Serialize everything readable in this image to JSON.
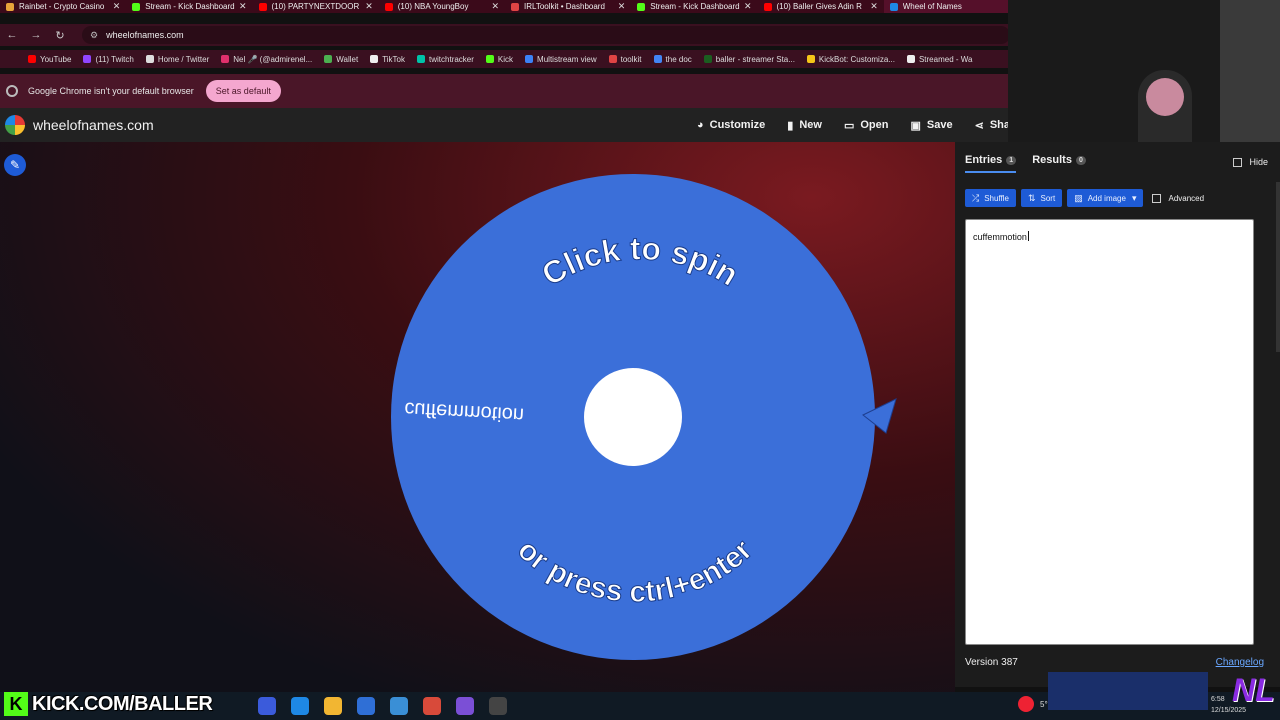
{
  "browser": {
    "tabs": [
      {
        "title": "Rainbet - Crypto Casino",
        "color": "#e8a33a"
      },
      {
        "title": "Stream - Kick Dashboard",
        "color": "#53fc18"
      },
      {
        "title": "(10) PARTYNEXTDOOR",
        "color": "#ff0000"
      },
      {
        "title": "(10) NBA YoungBoy",
        "color": "#ff0000"
      },
      {
        "title": "IRLToolkit • Dashboard",
        "color": "#e04444"
      },
      {
        "title": "Stream - Kick Dashboard",
        "color": "#53fc18"
      },
      {
        "title": "(10) Baller Gives Adin R",
        "color": "#ff0000"
      },
      {
        "title": "Wheel of Names",
        "color": "#1e88e5"
      }
    ],
    "url": "wheelofnames.com",
    "bookmarks": [
      {
        "label": "YouTube",
        "color": "#ff0000"
      },
      {
        "label": "(11) Twitch",
        "color": "#9146ff"
      },
      {
        "label": "Home / Twitter",
        "color": "#dddddd"
      },
      {
        "label": "Nel 🎤 (@admirenel...",
        "color": "#e1306c"
      },
      {
        "label": "Wallet",
        "color": "#4caf50"
      },
      {
        "label": "TikTok",
        "color": "#eeeeee"
      },
      {
        "label": "twitchtracker",
        "color": "#00c2a8"
      },
      {
        "label": "Kick",
        "color": "#53fc18"
      },
      {
        "label": "Multistream view",
        "color": "#3b82f6"
      },
      {
        "label": "toolkit",
        "color": "#e04444"
      },
      {
        "label": "the doc",
        "color": "#4285f4"
      },
      {
        "label": "baller - streamer Sta...",
        "color": "#1b5e20"
      },
      {
        "label": "KickBot: Customiza...",
        "color": "#f5c518"
      },
      {
        "label": "Streamed - Wa",
        "color": "#eeeeee"
      }
    ],
    "infobar": {
      "message": "Google Chrome isn't your default browser",
      "button": "Set as default"
    }
  },
  "site": {
    "name": "wheelofnames.com",
    "menu": [
      {
        "label": "Customize",
        "icon": "palette-icon"
      },
      {
        "label": "New",
        "icon": "file-icon"
      },
      {
        "label": "Open",
        "icon": "folder-open-icon"
      },
      {
        "label": "Save",
        "icon": "save-icon"
      },
      {
        "label": "Sha",
        "icon": "share-icon"
      }
    ]
  },
  "wheel": {
    "top_text": "Click to spin",
    "bottom_text": "or press ctrl+enter",
    "entry_label": "cuffemmotion",
    "color": "#3b6fd9",
    "pointer_color": "#3b6fd9"
  },
  "panel": {
    "tabs": [
      {
        "label": "Entries",
        "count": "1"
      },
      {
        "label": "Results",
        "count": "0"
      }
    ],
    "hide_label": "Hide",
    "buttons": {
      "shuffle": "Shuffle",
      "sort": "Sort",
      "add_image": "Add image",
      "advanced": "Advanced"
    },
    "entries_text": "cuffemmotion",
    "version": "Version 387",
    "changelog": "Changelog"
  },
  "overlay": {
    "kick_logo": "K",
    "kick_text": "KICK.COM/BALLER",
    "clock_time": "6:58",
    "clock_date": "12/15/2025",
    "tray_text": "5°",
    "watermark": "NL"
  }
}
